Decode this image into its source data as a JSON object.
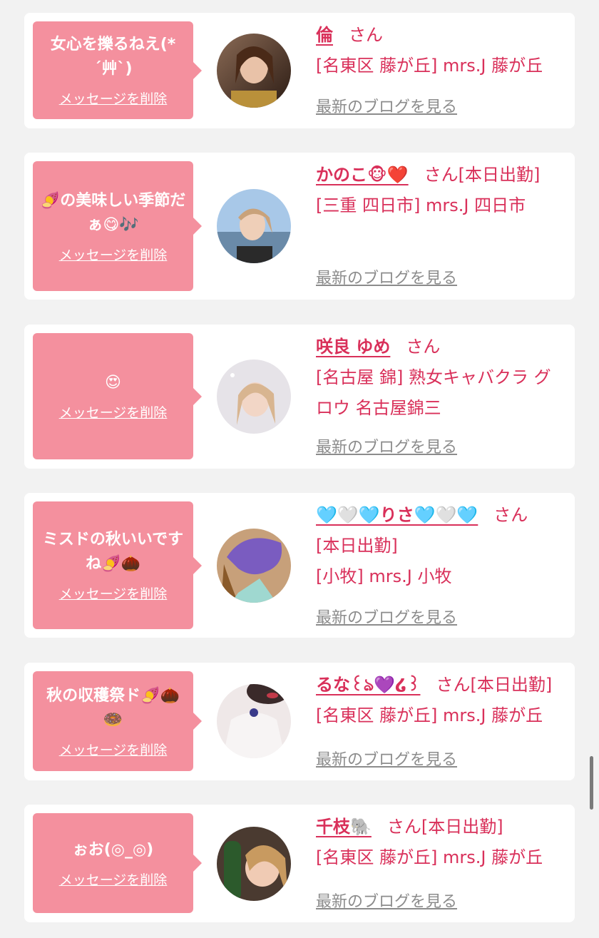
{
  "common": {
    "delete_label": "メッセージを削除",
    "blog_label": "最新のブログを見る",
    "honorific": "さん"
  },
  "colors": {
    "accent": "#d9305a",
    "bubble": "#f4909e",
    "blog_link": "#8c8c8c"
  },
  "items": [
    {
      "message": "女心を擽るねえ(*´艸`)",
      "name": "倫",
      "status": "",
      "location": "[名東区 藤が丘] mrs.J 藤が丘"
    },
    {
      "message": "🍠の美味しい季節だぁ😋🎶",
      "name": "かのこ🐵❤️",
      "status": "[本日出勤]",
      "location": "[三重 四日市] mrs.J 四日市"
    },
    {
      "message": "😍",
      "name": "咲良 ゆめ",
      "status": "",
      "location": "[名古屋 錦] 熟女キャバクラ グロウ 名古屋錦三"
    },
    {
      "message": "ミスドの秋いいですね🍠🌰",
      "name": "🩵🤍🩵りさ🩵🤍🩵",
      "status": "[本日出勤]",
      "location": "[小牧] mrs.J 小牧"
    },
    {
      "message": "秋の収穫祭ド🍠🌰🍩",
      "name": "るな꒰ঌ💜໒꒱",
      "status": "[本日出勤]",
      "location": "[名東区 藤が丘] mrs.J 藤が丘"
    },
    {
      "message": "ぉお(◎_◎)",
      "name": "千枝🐘",
      "status": "[本日出勤]",
      "location": "[名東区 藤が丘] mrs.J 藤が丘"
    }
  ]
}
